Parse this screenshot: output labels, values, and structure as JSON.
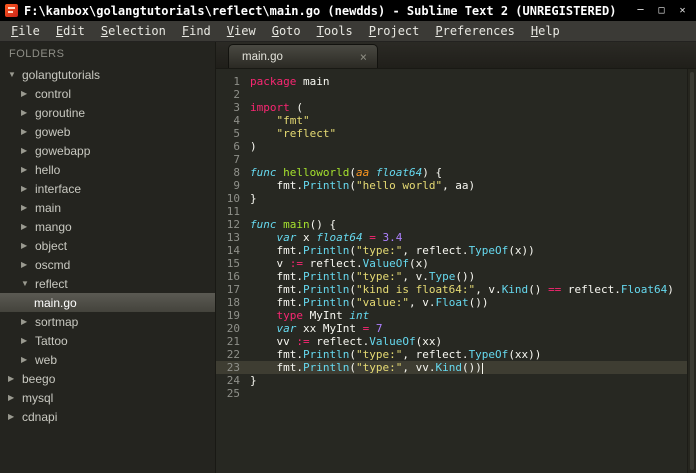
{
  "window": {
    "title": "F:\\kanbox\\golangtutorials\\reflect\\main.go (newdds) - Sublime Text 2 (UNREGISTERED)",
    "controls": {
      "minimize": "─",
      "maximize": "□",
      "close": "✕"
    }
  },
  "menu": {
    "items": [
      "File",
      "Edit",
      "Selection",
      "Find",
      "View",
      "Goto",
      "Tools",
      "Project",
      "Preferences",
      "Help"
    ]
  },
  "sidebar": {
    "header": "FOLDERS",
    "items": [
      {
        "label": "golangtutorials",
        "depth": 0,
        "state": "open",
        "kind": "folder"
      },
      {
        "label": "control",
        "depth": 1,
        "state": "closed",
        "kind": "folder"
      },
      {
        "label": "goroutine",
        "depth": 1,
        "state": "closed",
        "kind": "folder"
      },
      {
        "label": "goweb",
        "depth": 1,
        "state": "closed",
        "kind": "folder"
      },
      {
        "label": "gowebapp",
        "depth": 1,
        "state": "closed",
        "kind": "folder"
      },
      {
        "label": "hello",
        "depth": 1,
        "state": "closed",
        "kind": "folder"
      },
      {
        "label": "interface",
        "depth": 1,
        "state": "closed",
        "kind": "folder"
      },
      {
        "label": "main",
        "depth": 1,
        "state": "closed",
        "kind": "folder"
      },
      {
        "label": "mango",
        "depth": 1,
        "state": "closed",
        "kind": "folder"
      },
      {
        "label": "object",
        "depth": 1,
        "state": "closed",
        "kind": "folder"
      },
      {
        "label": "oscmd",
        "depth": 1,
        "state": "closed",
        "kind": "folder"
      },
      {
        "label": "reflect",
        "depth": 1,
        "state": "open",
        "kind": "folder"
      },
      {
        "label": "main.go",
        "depth": 2,
        "state": null,
        "kind": "file",
        "selected": true
      },
      {
        "label": "sortmap",
        "depth": 1,
        "state": "closed",
        "kind": "folder"
      },
      {
        "label": "Tattoo",
        "depth": 1,
        "state": "closed",
        "kind": "folder"
      },
      {
        "label": "web",
        "depth": 1,
        "state": "closed",
        "kind": "folder"
      },
      {
        "label": "beego",
        "depth": 0,
        "state": "closed",
        "kind": "folder"
      },
      {
        "label": "mysql",
        "depth": 0,
        "state": "closed",
        "kind": "folder"
      },
      {
        "label": "cdnapi",
        "depth": 0,
        "state": "closed",
        "kind": "folder"
      }
    ],
    "icons": {
      "open": "▼",
      "closed": "▶"
    }
  },
  "editor": {
    "tab": {
      "label": "main.go",
      "close": "×"
    },
    "current_line": 23,
    "cursor_line": 23,
    "lines": [
      [
        [
          "k",
          "package"
        ],
        [
          "p",
          " main"
        ]
      ],
      [],
      [
        [
          "k",
          "import"
        ],
        [
          "p",
          " ("
        ]
      ],
      [
        [
          "p",
          "    "
        ],
        [
          "s",
          "\"fmt\""
        ]
      ],
      [
        [
          "p",
          "    "
        ],
        [
          "s",
          "\"reflect\""
        ]
      ],
      [
        [
          "p",
          ")"
        ]
      ],
      [],
      [
        [
          "t",
          "func"
        ],
        [
          "p",
          " "
        ],
        [
          "f",
          "helloworld"
        ],
        [
          "p",
          "("
        ],
        [
          "a",
          "aa"
        ],
        [
          "p",
          " "
        ],
        [
          "t",
          "float64"
        ],
        [
          "p",
          ") {"
        ]
      ],
      [
        [
          "p",
          "    fmt."
        ],
        [
          "c",
          "Println"
        ],
        [
          "p",
          "("
        ],
        [
          "s",
          "\"hello world\""
        ],
        [
          "p",
          ", aa)"
        ]
      ],
      [
        [
          "p",
          "}"
        ]
      ],
      [],
      [
        [
          "t",
          "func"
        ],
        [
          "p",
          " "
        ],
        [
          "f",
          "main"
        ],
        [
          "p",
          "() {"
        ]
      ],
      [
        [
          "p",
          "    "
        ],
        [
          "t",
          "var"
        ],
        [
          "p",
          " x "
        ],
        [
          "t",
          "float64"
        ],
        [
          "p",
          " "
        ],
        [
          "k",
          "="
        ],
        [
          "p",
          " "
        ],
        [
          "n",
          "3.4"
        ]
      ],
      [
        [
          "p",
          "    fmt."
        ],
        [
          "c",
          "Println"
        ],
        [
          "p",
          "("
        ],
        [
          "s",
          "\"type:\""
        ],
        [
          "p",
          ", reflect."
        ],
        [
          "c",
          "TypeOf"
        ],
        [
          "p",
          "(x))"
        ]
      ],
      [
        [
          "p",
          "    v "
        ],
        [
          "k",
          ":="
        ],
        [
          "p",
          " reflect."
        ],
        [
          "c",
          "ValueOf"
        ],
        [
          "p",
          "(x)"
        ]
      ],
      [
        [
          "p",
          "    fmt."
        ],
        [
          "c",
          "Println"
        ],
        [
          "p",
          "("
        ],
        [
          "s",
          "\"type:\""
        ],
        [
          "p",
          ", v."
        ],
        [
          "c",
          "Type"
        ],
        [
          "p",
          "())"
        ]
      ],
      [
        [
          "p",
          "    fmt."
        ],
        [
          "c",
          "Println"
        ],
        [
          "p",
          "("
        ],
        [
          "s",
          "\"kind is float64:\""
        ],
        [
          "p",
          ", v."
        ],
        [
          "c",
          "Kind"
        ],
        [
          "p",
          "() "
        ],
        [
          "k",
          "=="
        ],
        [
          "p",
          " reflect."
        ],
        [
          "c",
          "Float64"
        ],
        [
          "p",
          ")"
        ]
      ],
      [
        [
          "p",
          "    fmt."
        ],
        [
          "c",
          "Println"
        ],
        [
          "p",
          "("
        ],
        [
          "s",
          "\"value:\""
        ],
        [
          "p",
          ", v."
        ],
        [
          "c",
          "Float"
        ],
        [
          "p",
          "())"
        ]
      ],
      [
        [
          "p",
          "    "
        ],
        [
          "k",
          "type"
        ],
        [
          "p",
          " MyInt "
        ],
        [
          "t",
          "int"
        ]
      ],
      [
        [
          "p",
          "    "
        ],
        [
          "t",
          "var"
        ],
        [
          "p",
          " xx MyInt "
        ],
        [
          "k",
          "="
        ],
        [
          "p",
          " "
        ],
        [
          "n",
          "7"
        ]
      ],
      [
        [
          "p",
          "    vv "
        ],
        [
          "k",
          ":="
        ],
        [
          "p",
          " reflect."
        ],
        [
          "c",
          "ValueOf"
        ],
        [
          "p",
          "(xx)"
        ]
      ],
      [
        [
          "p",
          "    fmt."
        ],
        [
          "c",
          "Println"
        ],
        [
          "p",
          "("
        ],
        [
          "s",
          "\"type:\""
        ],
        [
          "p",
          ", reflect."
        ],
        [
          "c",
          "TypeOf"
        ],
        [
          "p",
          "(xx))"
        ]
      ],
      [
        [
          "p",
          "    fmt."
        ],
        [
          "c",
          "Println"
        ],
        [
          "p",
          "("
        ],
        [
          "s",
          "\"type:\""
        ],
        [
          "p",
          ", vv."
        ],
        [
          "c",
          "Kind"
        ],
        [
          "p",
          "())"
        ]
      ],
      [
        [
          "p",
          "}"
        ]
      ],
      []
    ]
  },
  "colors": {
    "editor_bg": "#272822",
    "current_line_bg": "#3E3D32",
    "keyword_pink": "#F92672",
    "type_cyan": "#66D9EF",
    "func_green": "#A6E22E",
    "string_yellow": "#E6DB74",
    "number_purple": "#AE81FF",
    "param_orange": "#FD971F"
  }
}
